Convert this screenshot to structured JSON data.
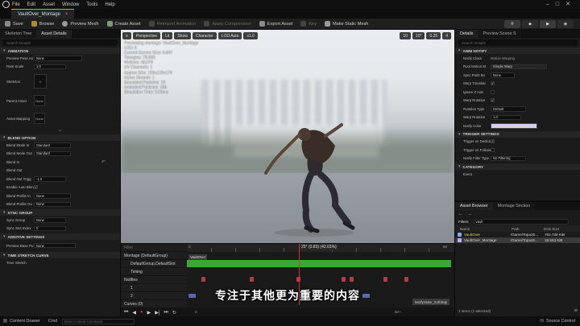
{
  "menu": {
    "items": [
      "File",
      "Edit",
      "Asset",
      "Window",
      "Tools",
      "Help"
    ]
  },
  "document_tab": {
    "title": "VaultOver_Montage"
  },
  "toolbar": {
    "items": [
      {
        "label": "Save",
        "icon": "save-icon",
        "enabled": true
      },
      {
        "label": "Browse",
        "icon": "browse-icon",
        "enabled": true
      },
      {
        "label": "Preview Mesh",
        "icon": "preview-mesh-icon",
        "enabled": true
      },
      {
        "label": "Create Asset",
        "icon": "create-asset-icon",
        "enabled": true
      },
      {
        "label": "Reimport Animation",
        "icon": "reimport-icon",
        "enabled": false
      },
      {
        "label": "Apply Compression",
        "icon": "compression-icon",
        "enabled": false
      },
      {
        "label": "Export Asset",
        "icon": "export-icon",
        "enabled": true
      },
      {
        "label": "Key",
        "icon": "key-icon",
        "enabled": false
      },
      {
        "label": "Make Static Mesh",
        "icon": "static-mesh-icon",
        "enabled": true
      }
    ]
  },
  "left_panel": {
    "tabs": [
      "Skeleton Tree",
      "Asset Details"
    ],
    "search_placeholder": "Search Details",
    "sections": {
      "animation": "ANIMATION",
      "blend": "BLEND OPTION",
      "sync": "SYNC GROUP",
      "additive": "ADDITIVE SETTINGS",
      "time_stretch": "TIME STRETCH CURVE"
    },
    "props": {
      "preview_pose_as": {
        "label": "Preview Pose As",
        "value": "None"
      },
      "rate_scale": {
        "label": "Rate Scale",
        "value": "1.0"
      },
      "skeleton": {
        "label": "Skeleton"
      },
      "parent_asset": {
        "label": "Parent Asset",
        "value": "None"
      },
      "asset_mapping": {
        "label": "Asset Mapping",
        "value": "None"
      },
      "blend_mode_in": {
        "label": "Blend Mode In",
        "value": "Standard"
      },
      "blend_mode_out": {
        "label": "Blend Mode Out",
        "value": "Standard"
      },
      "blend_in": {
        "label": "Blend In"
      },
      "blend_out": {
        "label": "Blend Out"
      },
      "blend_out_trigger": {
        "label": "Blend Out Trigg",
        "value": "-1.0"
      },
      "enable_auto_blend": {
        "label": "Enable Auto Blen"
      },
      "blend_profile_in": {
        "label": "Blend Profile In",
        "value": "None"
      },
      "blend_profile_out": {
        "label": "Blend Profile Ou",
        "value": "None"
      },
      "sync_group": {
        "label": "Sync Group",
        "value": "None"
      },
      "sync_slot_index": {
        "label": "Sync Slot Index",
        "value": "0"
      },
      "preview_base_pose": {
        "label": "Preview Base Po",
        "value": "None"
      },
      "time_stretch": {
        "label": "Time Stretch"
      }
    }
  },
  "viewport": {
    "buttons": [
      "Perspective",
      "Lit",
      "Show",
      "Character",
      "LOD Auto",
      "x1.0"
    ],
    "right_buttons": [
      "10",
      "10°",
      "0.25",
      "4"
    ],
    "stats": [
      "Previewing montage: VaultOver_Montage",
      "LOD: 0",
      "Current Screen Size: 0.697",
      "Triangles: 78,958",
      "Vertices: 48,979",
      "UV Channels: 1",
      "Approx Size: 193x120x179",
      "Active Strands: 1",
      "Simulated Particles: 19",
      "Animated Particles: 188",
      "Simulation Time: 0.00ms"
    ]
  },
  "right_panel": {
    "tabs": [
      "Details",
      "Preview Scene S"
    ],
    "search_placeholder": "Search Details",
    "sections": {
      "anim_notify": "ANIM NOTIFY",
      "trigger": "TRIGGER SETTINGS",
      "category": "CATEGORY"
    },
    "notify_class": {
      "label": "Notify Class",
      "value": "Motion Warping"
    },
    "root_motion": {
      "label": "Root Motion M",
      "value": "Simple Warp"
    },
    "props": {
      "sync_point_bo": {
        "label": "Sync Point Bo",
        "value": "None"
      },
      "warp_translation": {
        "label": "Warp Translati"
      },
      "ignore_z_axis": {
        "label": "Ignore Z Axis"
      },
      "warp_rotation": {
        "label": "Warp Rotation"
      },
      "rotation_type": {
        "label": "Rotation Type",
        "value": "Default"
      },
      "warp_rotation_time": {
        "label": "Warp Rotation",
        "value": "1.0"
      },
      "notify_color": {
        "label": "Notify Color"
      },
      "trigger_on_dedicated": {
        "label": "Trigger on Dedica"
      },
      "trigger_on_follower": {
        "label": "Trigger on Follower"
      },
      "notify_filter_type": {
        "label": "Notify Filter Type",
        "value": "No Filtering"
      },
      "event": {
        "label": "Event"
      }
    },
    "notify_color_hex": "#d8ccf0",
    "browser": {
      "tabs": [
        "Asset Browser",
        "Montage Section"
      ],
      "filters_label": "Filters",
      "search_value": "vault",
      "columns": [
        "Name",
        "Path",
        "Disk Size"
      ],
      "rows": [
        {
          "name": "VaultOver",
          "path": "/Game/TopazE...",
          "size": "762.728 KiB"
        },
        {
          "name": "VaultOver_Montage",
          "path": "/Game/TopazE...",
          "size": "18.553 KiB"
        }
      ],
      "footer": "2 items (1 selected)"
    }
  },
  "timeline": {
    "filter_placeholder": "Filter",
    "rows": [
      {
        "label": "Montage (DefaultGroup)"
      },
      {
        "label": "DefaultGroup.DefaultSlot"
      },
      {
        "label": "Timing"
      },
      {
        "label": "Notifies"
      },
      {
        "label": "1"
      },
      {
        "label": "2"
      },
      {
        "label": "Curves (0)"
      }
    ],
    "playhead_label": "25° (0.85) (42.03%)",
    "green_label": "VaultOver",
    "end_label": "NotifyState_SoftSkip",
    "ruler_marks": [
      "0",
      "25",
      "60"
    ],
    "timing_markers": [
      "1",
      "2",
      "3",
      "4",
      "5",
      "6",
      "7"
    ],
    "start_frame": "0",
    "end_frame": "60+"
  },
  "subtitle": "专注于其他更为重要的内容",
  "statusbar": {
    "content_drawer": "Content Drawer",
    "cmd": "Cmd",
    "console_placeholder": "Enter Console Command",
    "source_control": "Source Control"
  }
}
